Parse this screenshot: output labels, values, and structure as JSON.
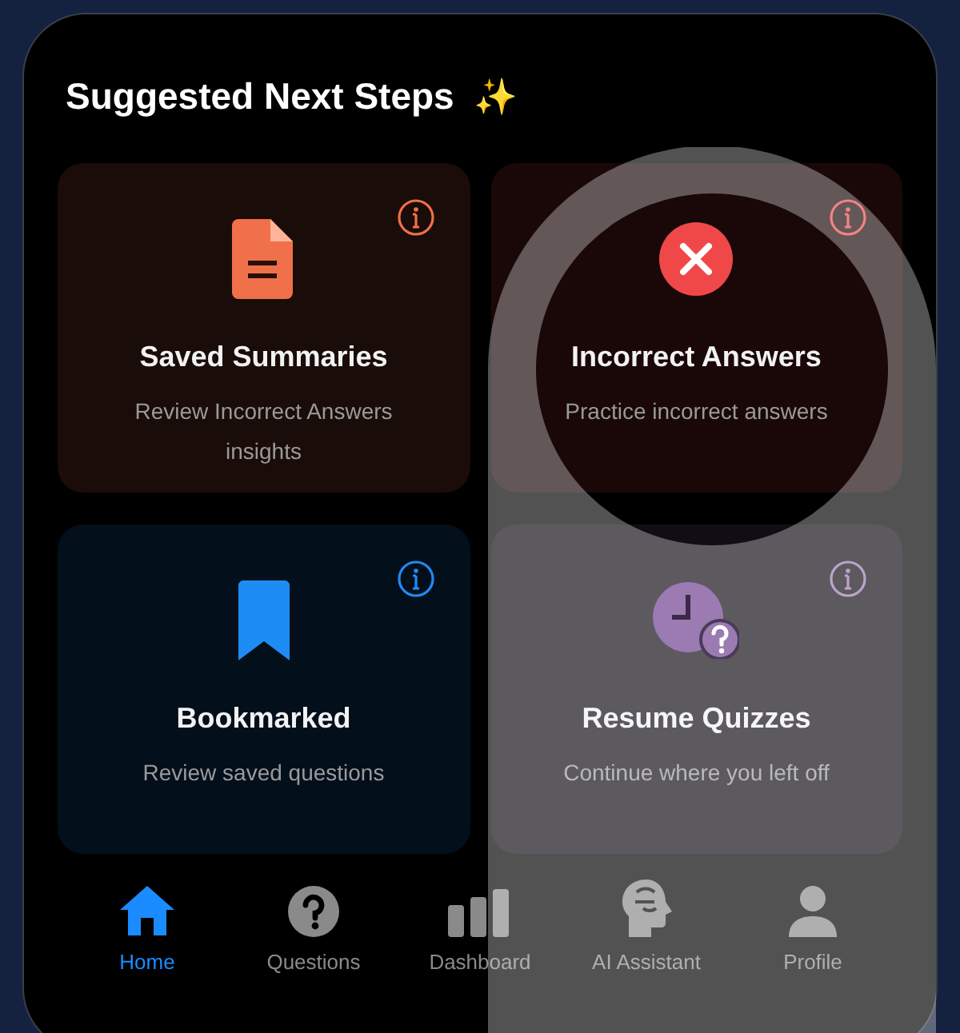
{
  "title": "Suggested Next Steps",
  "title_icon": "✨",
  "cards": [
    {
      "kind": "document",
      "color": "#f0704a",
      "title": "Saved Summaries",
      "subtitle": "Review Incorrect Answers insights"
    },
    {
      "kind": "error",
      "color": "#f04848",
      "title": "Incorrect Answers",
      "subtitle": "Practice incorrect answers"
    },
    {
      "kind": "bookmark",
      "color": "#1e8cf5",
      "title": "Bookmarked",
      "subtitle": "Review saved questions"
    },
    {
      "kind": "clock",
      "color": "#9c7ab2",
      "title": "Resume Quizzes",
      "subtitle": "Continue where you left off"
    }
  ],
  "tabs": [
    {
      "kind": "home",
      "label": "Home",
      "selected": true
    },
    {
      "kind": "questions",
      "label": "Questions",
      "selected": false
    },
    {
      "kind": "dashboard",
      "label": "Dashboard",
      "selected": false
    },
    {
      "kind": "assistant",
      "label": "AI Assistant",
      "selected": false
    },
    {
      "kind": "profile",
      "label": "Profile",
      "selected": false
    }
  ]
}
